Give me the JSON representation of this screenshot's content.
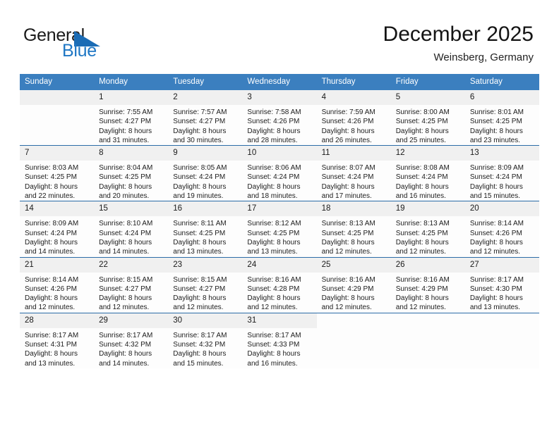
{
  "brand": {
    "name_part1": "General",
    "name_part2": "Blue",
    "logo_icon": "triangle-logo-icon"
  },
  "header": {
    "title": "December 2025",
    "subtitle": "Weinsberg, Germany"
  },
  "colors": {
    "header_blue": "#3b7fbf",
    "rule_blue": "#2b6ca8",
    "daynum_band": "#f0f0f0",
    "brand_blue": "#1f77c4"
  },
  "calendar": {
    "weekday_headers": [
      "Sunday",
      "Monday",
      "Tuesday",
      "Wednesday",
      "Thursday",
      "Friday",
      "Saturday"
    ],
    "weeks": [
      [
        {
          "day": "",
          "lines": [],
          "empty": true
        },
        {
          "day": "1",
          "lines": [
            "Sunrise: 7:55 AM",
            "Sunset: 4:27 PM",
            "Daylight: 8 hours",
            "and 31 minutes."
          ]
        },
        {
          "day": "2",
          "lines": [
            "Sunrise: 7:57 AM",
            "Sunset: 4:27 PM",
            "Daylight: 8 hours",
            "and 30 minutes."
          ]
        },
        {
          "day": "3",
          "lines": [
            "Sunrise: 7:58 AM",
            "Sunset: 4:26 PM",
            "Daylight: 8 hours",
            "and 28 minutes."
          ]
        },
        {
          "day": "4",
          "lines": [
            "Sunrise: 7:59 AM",
            "Sunset: 4:26 PM",
            "Daylight: 8 hours",
            "and 26 minutes."
          ]
        },
        {
          "day": "5",
          "lines": [
            "Sunrise: 8:00 AM",
            "Sunset: 4:25 PM",
            "Daylight: 8 hours",
            "and 25 minutes."
          ]
        },
        {
          "day": "6",
          "lines": [
            "Sunrise: 8:01 AM",
            "Sunset: 4:25 PM",
            "Daylight: 8 hours",
            "and 23 minutes."
          ]
        }
      ],
      [
        {
          "day": "7",
          "lines": [
            "Sunrise: 8:03 AM",
            "Sunset: 4:25 PM",
            "Daylight: 8 hours",
            "and 22 minutes."
          ]
        },
        {
          "day": "8",
          "lines": [
            "Sunrise: 8:04 AM",
            "Sunset: 4:25 PM",
            "Daylight: 8 hours",
            "and 20 minutes."
          ]
        },
        {
          "day": "9",
          "lines": [
            "Sunrise: 8:05 AM",
            "Sunset: 4:24 PM",
            "Daylight: 8 hours",
            "and 19 minutes."
          ]
        },
        {
          "day": "10",
          "lines": [
            "Sunrise: 8:06 AM",
            "Sunset: 4:24 PM",
            "Daylight: 8 hours",
            "and 18 minutes."
          ]
        },
        {
          "day": "11",
          "lines": [
            "Sunrise: 8:07 AM",
            "Sunset: 4:24 PM",
            "Daylight: 8 hours",
            "and 17 minutes."
          ]
        },
        {
          "day": "12",
          "lines": [
            "Sunrise: 8:08 AM",
            "Sunset: 4:24 PM",
            "Daylight: 8 hours",
            "and 16 minutes."
          ]
        },
        {
          "day": "13",
          "lines": [
            "Sunrise: 8:09 AM",
            "Sunset: 4:24 PM",
            "Daylight: 8 hours",
            "and 15 minutes."
          ]
        }
      ],
      [
        {
          "day": "14",
          "lines": [
            "Sunrise: 8:09 AM",
            "Sunset: 4:24 PM",
            "Daylight: 8 hours",
            "and 14 minutes."
          ]
        },
        {
          "day": "15",
          "lines": [
            "Sunrise: 8:10 AM",
            "Sunset: 4:24 PM",
            "Daylight: 8 hours",
            "and 14 minutes."
          ]
        },
        {
          "day": "16",
          "lines": [
            "Sunrise: 8:11 AM",
            "Sunset: 4:25 PM",
            "Daylight: 8 hours",
            "and 13 minutes."
          ]
        },
        {
          "day": "17",
          "lines": [
            "Sunrise: 8:12 AM",
            "Sunset: 4:25 PM",
            "Daylight: 8 hours",
            "and 13 minutes."
          ]
        },
        {
          "day": "18",
          "lines": [
            "Sunrise: 8:13 AM",
            "Sunset: 4:25 PM",
            "Daylight: 8 hours",
            "and 12 minutes."
          ]
        },
        {
          "day": "19",
          "lines": [
            "Sunrise: 8:13 AM",
            "Sunset: 4:25 PM",
            "Daylight: 8 hours",
            "and 12 minutes."
          ]
        },
        {
          "day": "20",
          "lines": [
            "Sunrise: 8:14 AM",
            "Sunset: 4:26 PM",
            "Daylight: 8 hours",
            "and 12 minutes."
          ]
        }
      ],
      [
        {
          "day": "21",
          "lines": [
            "Sunrise: 8:14 AM",
            "Sunset: 4:26 PM",
            "Daylight: 8 hours",
            "and 12 minutes."
          ]
        },
        {
          "day": "22",
          "lines": [
            "Sunrise: 8:15 AM",
            "Sunset: 4:27 PM",
            "Daylight: 8 hours",
            "and 12 minutes."
          ]
        },
        {
          "day": "23",
          "lines": [
            "Sunrise: 8:15 AM",
            "Sunset: 4:27 PM",
            "Daylight: 8 hours",
            "and 12 minutes."
          ]
        },
        {
          "day": "24",
          "lines": [
            "Sunrise: 8:16 AM",
            "Sunset: 4:28 PM",
            "Daylight: 8 hours",
            "and 12 minutes."
          ]
        },
        {
          "day": "25",
          "lines": [
            "Sunrise: 8:16 AM",
            "Sunset: 4:29 PM",
            "Daylight: 8 hours",
            "and 12 minutes."
          ]
        },
        {
          "day": "26",
          "lines": [
            "Sunrise: 8:16 AM",
            "Sunset: 4:29 PM",
            "Daylight: 8 hours",
            "and 12 minutes."
          ]
        },
        {
          "day": "27",
          "lines": [
            "Sunrise: 8:17 AM",
            "Sunset: 4:30 PM",
            "Daylight: 8 hours",
            "and 13 minutes."
          ]
        }
      ],
      [
        {
          "day": "28",
          "lines": [
            "Sunrise: 8:17 AM",
            "Sunset: 4:31 PM",
            "Daylight: 8 hours",
            "and 13 minutes."
          ]
        },
        {
          "day": "29",
          "lines": [
            "Sunrise: 8:17 AM",
            "Sunset: 4:32 PM",
            "Daylight: 8 hours",
            "and 14 minutes."
          ]
        },
        {
          "day": "30",
          "lines": [
            "Sunrise: 8:17 AM",
            "Sunset: 4:32 PM",
            "Daylight: 8 hours",
            "and 15 minutes."
          ]
        },
        {
          "day": "31",
          "lines": [
            "Sunrise: 8:17 AM",
            "Sunset: 4:33 PM",
            "Daylight: 8 hours",
            "and 16 minutes."
          ]
        },
        {
          "day": "",
          "lines": [],
          "blank": true
        },
        {
          "day": "",
          "lines": [],
          "blank": true
        },
        {
          "day": "",
          "lines": [],
          "blank": true
        }
      ]
    ]
  }
}
